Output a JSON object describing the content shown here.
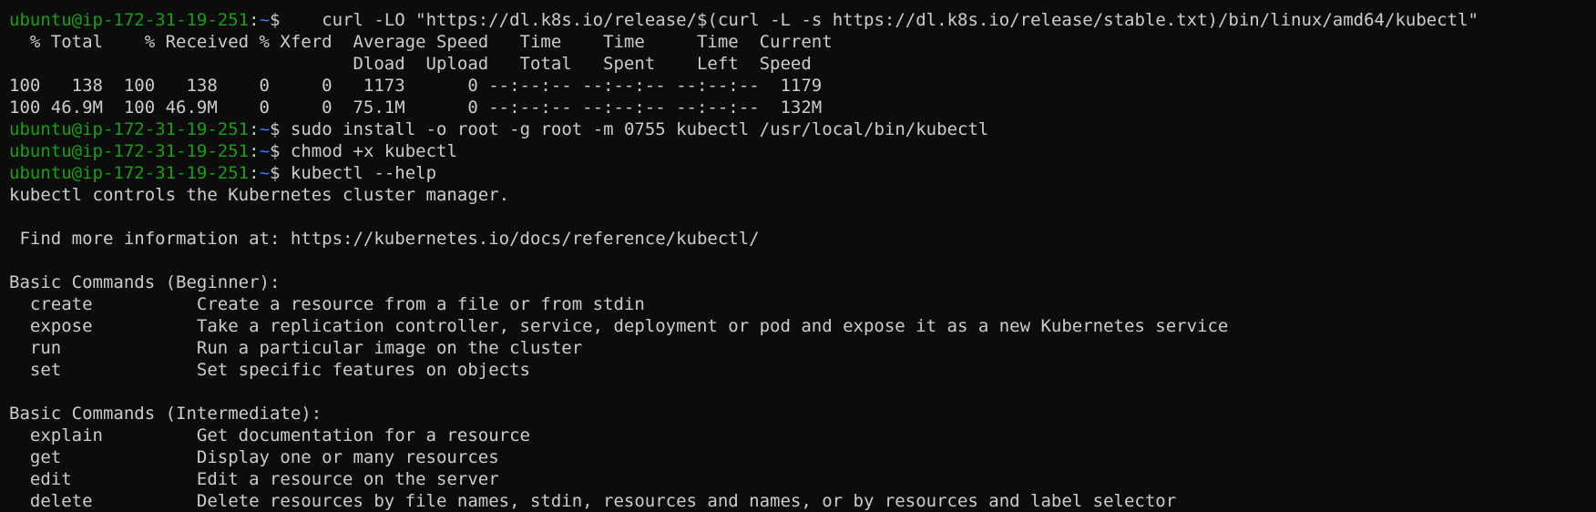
{
  "prompt": {
    "user_host": "ubuntu@ip-172-31-19-251",
    "colon": ":",
    "path": "~",
    "dollar": "$"
  },
  "lines": [
    {
      "type": "prompt",
      "cmd": "    curl -LO \"https://dl.k8s.io/release/$(curl -L -s https://dl.k8s.io/release/stable.txt)/bin/linux/amd64/kubectl\""
    },
    {
      "type": "output",
      "text": "  % Total    % Received % Xferd  Average Speed   Time    Time     Time  Current"
    },
    {
      "type": "output",
      "text": "                                 Dload  Upload   Total   Spent    Left  Speed"
    },
    {
      "type": "output",
      "text": "100   138  100   138    0     0   1173      0 --:--:-- --:--:-- --:--:--  1179"
    },
    {
      "type": "output",
      "text": "100 46.9M  100 46.9M    0     0  75.1M      0 --:--:-- --:--:-- --:--:--  132M"
    },
    {
      "type": "prompt",
      "cmd": " sudo install -o root -g root -m 0755 kubectl /usr/local/bin/kubectl"
    },
    {
      "type": "prompt",
      "cmd": " chmod +x kubectl"
    },
    {
      "type": "prompt",
      "cmd": " kubectl --help"
    },
    {
      "type": "output",
      "text": "kubectl controls the Kubernetes cluster manager."
    },
    {
      "type": "output",
      "text": ""
    },
    {
      "type": "output",
      "text": " Find more information at: https://kubernetes.io/docs/reference/kubectl/"
    },
    {
      "type": "output",
      "text": ""
    },
    {
      "type": "output",
      "text": "Basic Commands (Beginner):"
    },
    {
      "type": "output",
      "text": "  create          Create a resource from a file or from stdin"
    },
    {
      "type": "output",
      "text": "  expose          Take a replication controller, service, deployment or pod and expose it as a new Kubernetes service"
    },
    {
      "type": "output",
      "text": "  run             Run a particular image on the cluster"
    },
    {
      "type": "output",
      "text": "  set             Set specific features on objects"
    },
    {
      "type": "output",
      "text": ""
    },
    {
      "type": "output",
      "text": "Basic Commands (Intermediate):"
    },
    {
      "type": "output",
      "text": "  explain         Get documentation for a resource"
    },
    {
      "type": "output",
      "text": "  get             Display one or many resources"
    },
    {
      "type": "output",
      "text": "  edit            Edit a resource on the server"
    },
    {
      "type": "output",
      "text": "  delete          Delete resources by file names, stdin, resources and names, or by resources and label selector"
    }
  ],
  "colors": {
    "background": "#0c0c0c",
    "foreground": "#cccccc",
    "prompt_user": "#13a10e",
    "prompt_path": "#3b78ff"
  }
}
